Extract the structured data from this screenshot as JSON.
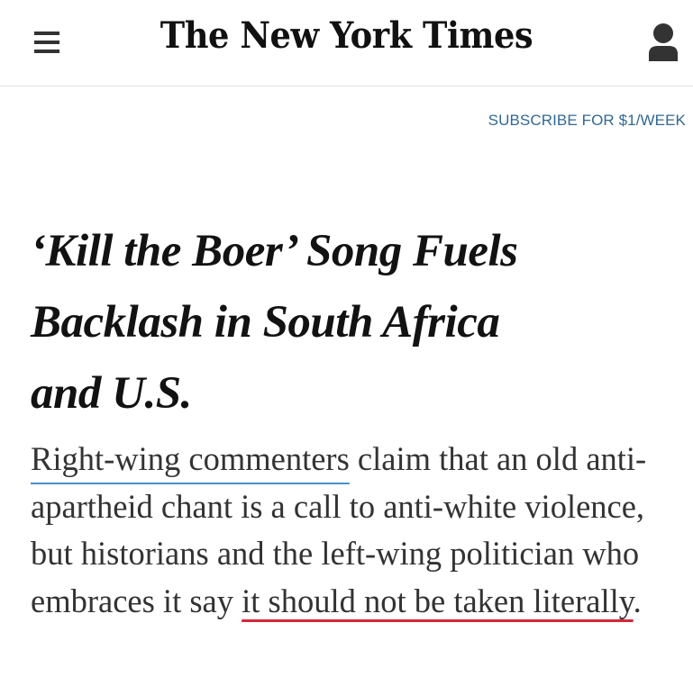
{
  "header": {
    "logo_text": "The New York Times",
    "menu_icon": "hamburger-menu-icon",
    "account_icon": "user-account-icon",
    "subscribe_label": "SUBSCRIBE FOR $1/WEEK",
    "subscribe_color": "#326891"
  },
  "article": {
    "headline_line1": "‘Kill the Boer’ Song Fuels",
    "headline_line2": "Backlash in South Africa",
    "headline_line3": "and U.S.",
    "summary_part1": "Right-wing commenters",
    "summary_part2": " claim that an old anti-apartheid chant is a call to anti-white violence, but historians and the left-wing politician who embraces it say ",
    "summary_part3": "it should not be taken literally",
    "summary_part4": ".",
    "highlight_colors": {
      "blue_underline": "#4a90c8",
      "red_underline": "#d6263a"
    }
  }
}
